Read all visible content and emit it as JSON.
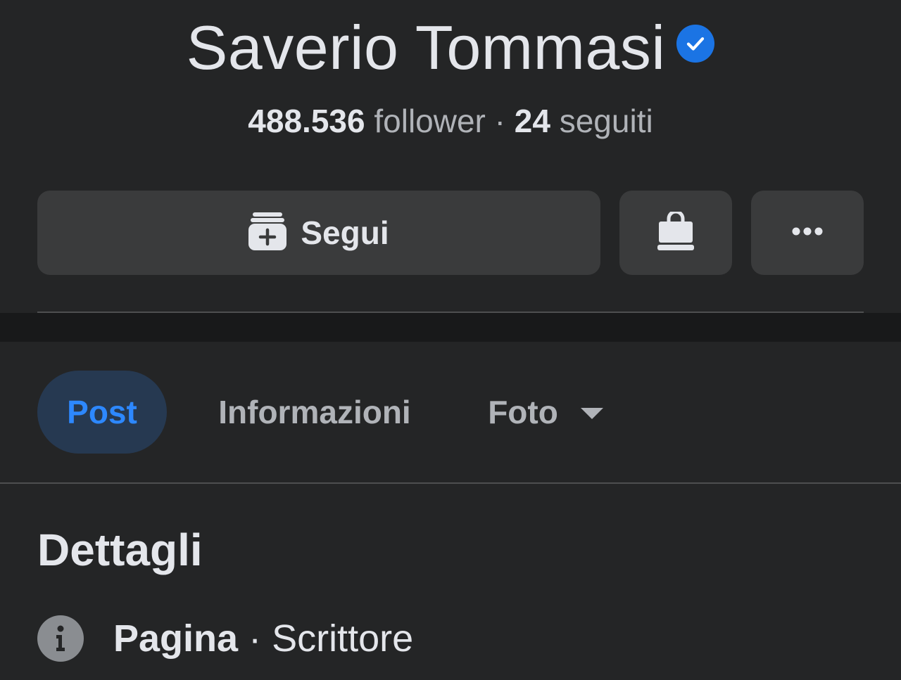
{
  "profile": {
    "name": "Saverio Tommasi",
    "followers_count": "488.536",
    "followers_label": "follower",
    "separator": "·",
    "following_count": "24",
    "following_label": "seguiti"
  },
  "actions": {
    "follow_label": "Segui",
    "shop_icon": "shopping-bag-icon",
    "more_icon": "more-dots-icon"
  },
  "tabs": [
    {
      "label": "Post",
      "active": true
    },
    {
      "label": "Informazioni",
      "active": false
    },
    {
      "label": "Foto",
      "active": false
    }
  ],
  "details": {
    "title": "Dettagli",
    "category_prefix": "Pagina",
    "category_separator": " · ",
    "category_value": "Scrittore"
  },
  "colors": {
    "background": "#242526",
    "button_bg": "#3a3b3c",
    "active_tab_text": "#2d88ff",
    "verified": "#1b74e4"
  }
}
